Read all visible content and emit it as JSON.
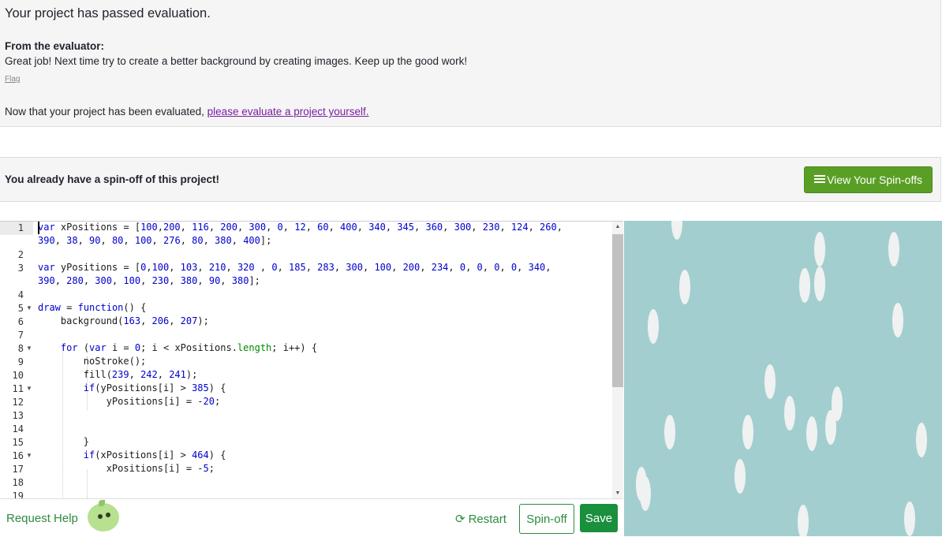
{
  "evaluation": {
    "title": "Your project has passed evaluation.",
    "from_label": "From the evaluator:",
    "message": "Great job! Next time try to create a better background by creating images. Keep up the good work!",
    "flag_label": "Flag",
    "now_prefix": "Now that your project has been evaluated, ",
    "now_link": "please evaluate a project yourself."
  },
  "spinoff_panel": {
    "message": "You already have a spin-off of this project!",
    "button_label": "View Your Spin-offs",
    "button_icon": "list-icon",
    "button_color": "#5a9f25"
  },
  "editor": {
    "line_numbers": [
      "1",
      "2",
      "3",
      "4",
      "5",
      "6",
      "7",
      "8",
      "9",
      "10",
      "11",
      "12",
      "13",
      "14",
      "15",
      "16",
      "17",
      "18",
      "19"
    ],
    "foldable_lines": [
      "5",
      "8",
      "11",
      "16"
    ]
  },
  "canvas": {
    "background_color": "#a3cecf",
    "flake_color": "#eff2f1"
  },
  "bottom_bar": {
    "help_label": "Request Help",
    "restart_label": "Restart",
    "restart_icon": "refresh-icon",
    "spinoff_label": "Spin-off",
    "save_label": "Save",
    "accent_color": "#2e8b3e"
  }
}
